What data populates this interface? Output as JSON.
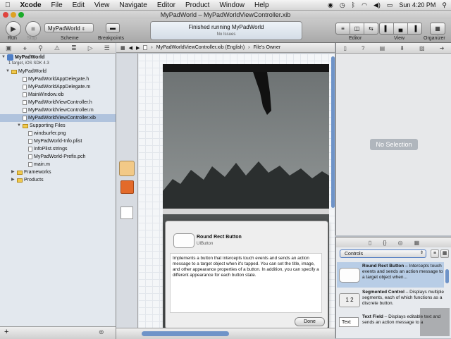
{
  "menubar": {
    "apple": "",
    "items": [
      "Xcode",
      "File",
      "Edit",
      "View",
      "Navigate",
      "Editor",
      "Product",
      "Window",
      "Help"
    ],
    "clock": "Sun 4:20 PM"
  },
  "window": {
    "title": "MyPadWorld – MyPadWorldViewController.xib"
  },
  "toolbar": {
    "run_label": "Run",
    "stop_label": "Stop",
    "scheme_label": "Scheme",
    "breakpoints_label": "Breakpoints",
    "scheme_value": "MyPadWorld",
    "activity_status": "Finished running MyPadWorld",
    "activity_issues": "No Issues",
    "editor_label": "Editor",
    "view_label": "View",
    "organizer_label": "Organizer"
  },
  "navigator": {
    "project_name": "MyPadWorld",
    "project_sub": "1 target, iOS SDK 4.3",
    "items": [
      {
        "label": "MyPadWorld",
        "kind": "folder"
      },
      {
        "label": "MyPadWorldAppDelegate.h",
        "kind": "h"
      },
      {
        "label": "MyPadWorldAppDelegate.m",
        "kind": "m"
      },
      {
        "label": "MainWindow.xib",
        "kind": "xib"
      },
      {
        "label": "MyPadWorldViewController.h",
        "kind": "h"
      },
      {
        "label": "MyPadWorldViewController.m",
        "kind": "m"
      },
      {
        "label": "MyPadWorldViewController.xib",
        "kind": "xib"
      },
      {
        "label": "Supporting Files",
        "kind": "folder"
      },
      {
        "label": "windsurfer.png",
        "kind": "png"
      },
      {
        "label": "MyPadWorld-Info.plist",
        "kind": "plist"
      },
      {
        "label": "InfoPlist.strings",
        "kind": "strings"
      },
      {
        "label": "MyPadWorld-Prefix.pch",
        "kind": "pch"
      },
      {
        "label": "main.m",
        "kind": "m"
      },
      {
        "label": "Frameworks",
        "kind": "folder"
      },
      {
        "label": "Products",
        "kind": "folder"
      }
    ]
  },
  "jumpbar": {
    "file": "MyPadWorldViewController.xib (English)",
    "owner": "File's Owner"
  },
  "popover": {
    "title": "Round Rect Button",
    "class": "UIButton",
    "description": "Implements a button that intercepts touch events and sends an action message to a target object when it's tapped. You can set the title, image, and other appearance properties of a button. In addition, you can specify a different appearance for each button state.",
    "done_label": "Done"
  },
  "inspector": {
    "no_selection": "No Selection"
  },
  "library": {
    "selected_category": "Controls",
    "items": [
      {
        "title": "Round Rect Button",
        "desc": " – Intercepts touch events and sends an action message to a target object when..."
      },
      {
        "title": "Segmented Control",
        "desc": " – Displays multiple segments, each of which functions as a discrete button."
      },
      {
        "title": "Text Field",
        "desc": " – Displays editable text and sends an action message to a"
      }
    ],
    "segment_preview": "1  2",
    "textfield_preview": "Text"
  },
  "colors": {
    "selection": "#b0c3dd",
    "accent": "#4d7ac2",
    "navigator_bg": "#e3e8ee"
  }
}
